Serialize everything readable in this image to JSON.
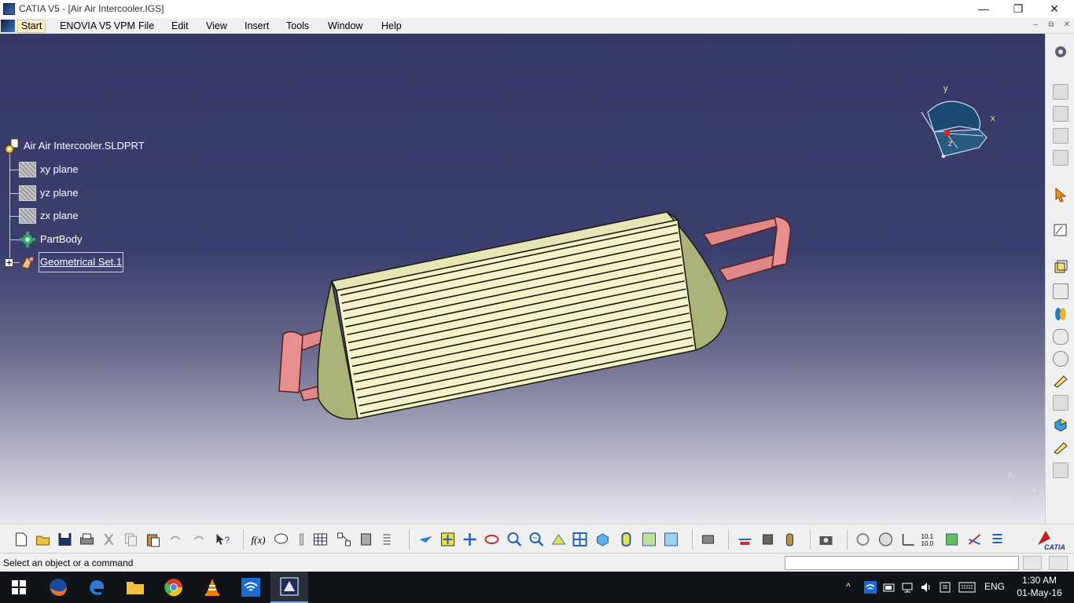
{
  "window": {
    "title": "CATIA V5 - [Air Air Intercooler.IGS]",
    "minimize_glyph": "—",
    "restore_glyph": "❐",
    "close_glyph": "✕"
  },
  "menubar": {
    "items": [
      "Start",
      "ENOVIA V5 VPM",
      "File",
      "Edit",
      "View",
      "Insert",
      "Tools",
      "Window",
      "Help"
    ],
    "mdi_minimize": "‒",
    "mdi_restore": "⧉",
    "mdi_close": "✕"
  },
  "tree": {
    "root": "Air Air Intercooler.SLDPRT",
    "children": [
      "xy plane",
      "yz plane",
      "zx plane",
      "PartBody",
      "Geometrical Set.1"
    ]
  },
  "compass": {
    "x": "x",
    "y": "y",
    "z": "z"
  },
  "axis_triad": {
    "x": "x",
    "y": "y"
  },
  "status": {
    "message": "Select an object or a command"
  },
  "taskbar": {
    "language": "ENG",
    "time": "1:30 AM",
    "date": "01-May-16"
  },
  "colors": {
    "viewport_top": "#363968",
    "core_face": "#f4f2c8",
    "side_tank": "#aab278",
    "pipe": "#e08888"
  }
}
